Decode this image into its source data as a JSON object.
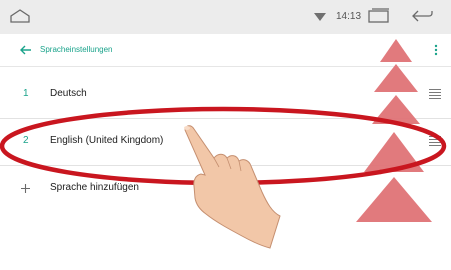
{
  "status_bar": {
    "time": "14:13",
    "icons": [
      "home-outline-icon",
      "wifi-icon",
      "recent-apps-icon",
      "back-arrow-icon"
    ]
  },
  "toolbar": {
    "back_icon": "arrow-left-icon",
    "title": "Spracheinstellungen",
    "menu_icon": "more-vert-icon"
  },
  "languages": [
    {
      "number": "1",
      "label": "Deutsch"
    },
    {
      "number": "2",
      "label": "English (United Kingdom)"
    }
  ],
  "add_language": {
    "icon": "plus-icon",
    "label": "Sprache hinzufügen"
  },
  "colors": {
    "accent": "#1aa38b",
    "highlight_ellipse": "#c9161f",
    "triangle": "#e07377"
  }
}
